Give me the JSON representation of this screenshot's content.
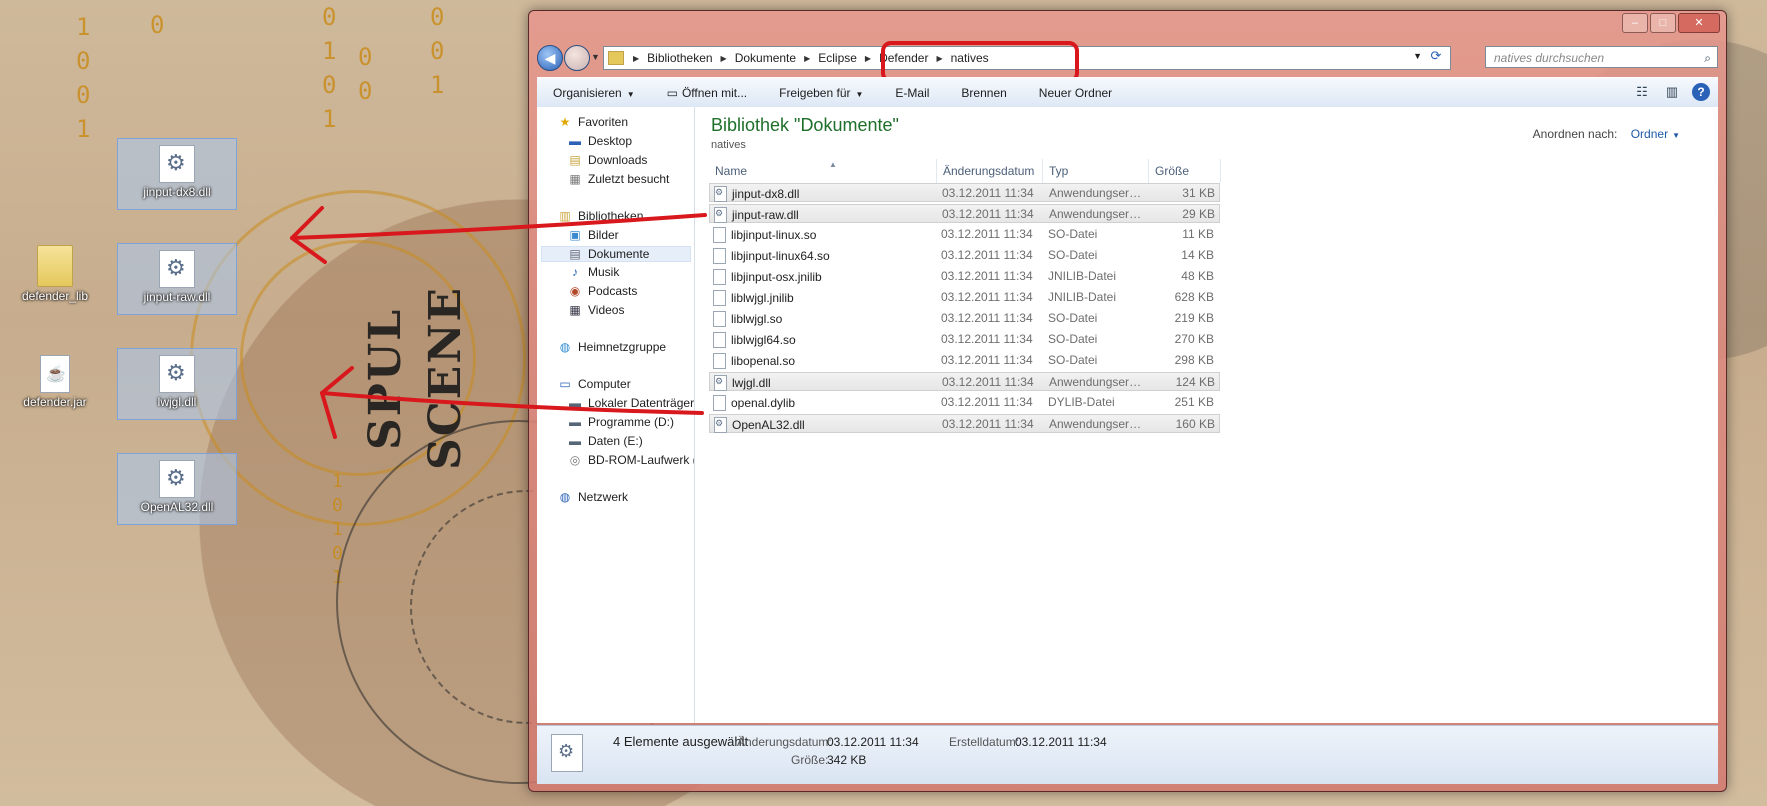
{
  "desktop": {
    "icons": [
      {
        "label": "jinput-dx8.dll"
      },
      {
        "label": "jinput-raw.dll"
      },
      {
        "label": "lwjgl.dll"
      },
      {
        "label": "OpenAL32.dll"
      },
      {
        "label": "defender_lib"
      },
      {
        "label": "defender.jar"
      }
    ]
  },
  "window": {
    "controls": {
      "minimize": "–",
      "maximize": "□",
      "close": "✕"
    },
    "address": {
      "crumbs": [
        "Bibliotheken",
        "Dokumente",
        "Eclipse",
        "Defender",
        "natives"
      ],
      "search_placeholder": "natives durchsuchen"
    },
    "toolbar": {
      "organize": "Organisieren",
      "open_with": "Öffnen mit...",
      "share": "Freigeben für",
      "email": "E-Mail",
      "burn": "Brennen",
      "new_folder": "Neuer Ordner"
    },
    "nav": {
      "favorites": "Favoriten",
      "desktop": "Desktop",
      "downloads": "Downloads",
      "recent": "Zuletzt besucht",
      "libraries": "Bibliotheken",
      "pictures": "Bilder",
      "documents": "Dokumente",
      "music": "Musik",
      "podcasts": "Podcasts",
      "videos": "Videos",
      "homegroup": "Heimnetzgruppe",
      "computer": "Computer",
      "local_disk": "Lokaler Datenträger",
      "programs": "Programme (D:)",
      "data": "Daten (E:)",
      "bdrom": "BD-ROM-Laufwerk (",
      "network": "Netzwerk"
    },
    "main": {
      "title": "Bibliothek \"Dokumente\"",
      "subtitle": "natives",
      "arrange_label": "Anordnen nach:",
      "arrange_value": "Ordner",
      "columns": {
        "name": "Name",
        "date": "Änderungsdatum",
        "type": "Typ",
        "size": "Größe"
      },
      "files": [
        {
          "name": "jinput-dx8.dll",
          "date": "03.12.2011 11:34",
          "type": "Anwendungserwe...",
          "size": "31 KB",
          "selected": true,
          "dll": true
        },
        {
          "name": "jinput-raw.dll",
          "date": "03.12.2011 11:34",
          "type": "Anwendungserwe...",
          "size": "29 KB",
          "selected": true,
          "dll": true
        },
        {
          "name": "libjinput-linux.so",
          "date": "03.12.2011 11:34",
          "type": "SO-Datei",
          "size": "11 KB",
          "selected": false,
          "dll": false
        },
        {
          "name": "libjinput-linux64.so",
          "date": "03.12.2011 11:34",
          "type": "SO-Datei",
          "size": "14 KB",
          "selected": false,
          "dll": false
        },
        {
          "name": "libjinput-osx.jnilib",
          "date": "03.12.2011 11:34",
          "type": "JNILIB-Datei",
          "size": "48 KB",
          "selected": false,
          "dll": false
        },
        {
          "name": "liblwjgl.jnilib",
          "date": "03.12.2011 11:34",
          "type": "JNILIB-Datei",
          "size": "628 KB",
          "selected": false,
          "dll": false
        },
        {
          "name": "liblwjgl.so",
          "date": "03.12.2011 11:34",
          "type": "SO-Datei",
          "size": "219 KB",
          "selected": false,
          "dll": false
        },
        {
          "name": "liblwjgl64.so",
          "date": "03.12.2011 11:34",
          "type": "SO-Datei",
          "size": "270 KB",
          "selected": false,
          "dll": false
        },
        {
          "name": "libopenal.so",
          "date": "03.12.2011 11:34",
          "type": "SO-Datei",
          "size": "298 KB",
          "selected": false,
          "dll": false
        },
        {
          "name": "lwjgl.dll",
          "date": "03.12.2011 11:34",
          "type": "Anwendungserwe...",
          "size": "124 KB",
          "selected": true,
          "dll": true
        },
        {
          "name": "openal.dylib",
          "date": "03.12.2011 11:34",
          "type": "DYLIB-Datei",
          "size": "251 KB",
          "selected": false,
          "dll": false
        },
        {
          "name": "OpenAL32.dll",
          "date": "03.12.2011 11:34",
          "type": "Anwendungserwe...",
          "size": "160 KB",
          "selected": true,
          "dll": true
        }
      ]
    },
    "details": {
      "count": "4 Elemente ausgewählt",
      "modified_label": "Änderungsdatum:",
      "modified_value": "03.12.2011 11:34",
      "created_label": "Erstelldatum:",
      "created_value": "03.12.2011 11:34",
      "size_label": "Größe:",
      "size_value": "342 KB"
    }
  },
  "colors": {
    "annotation": "#d9181d",
    "library_title": "#1e6f2a",
    "link": "#1e5aa8"
  }
}
